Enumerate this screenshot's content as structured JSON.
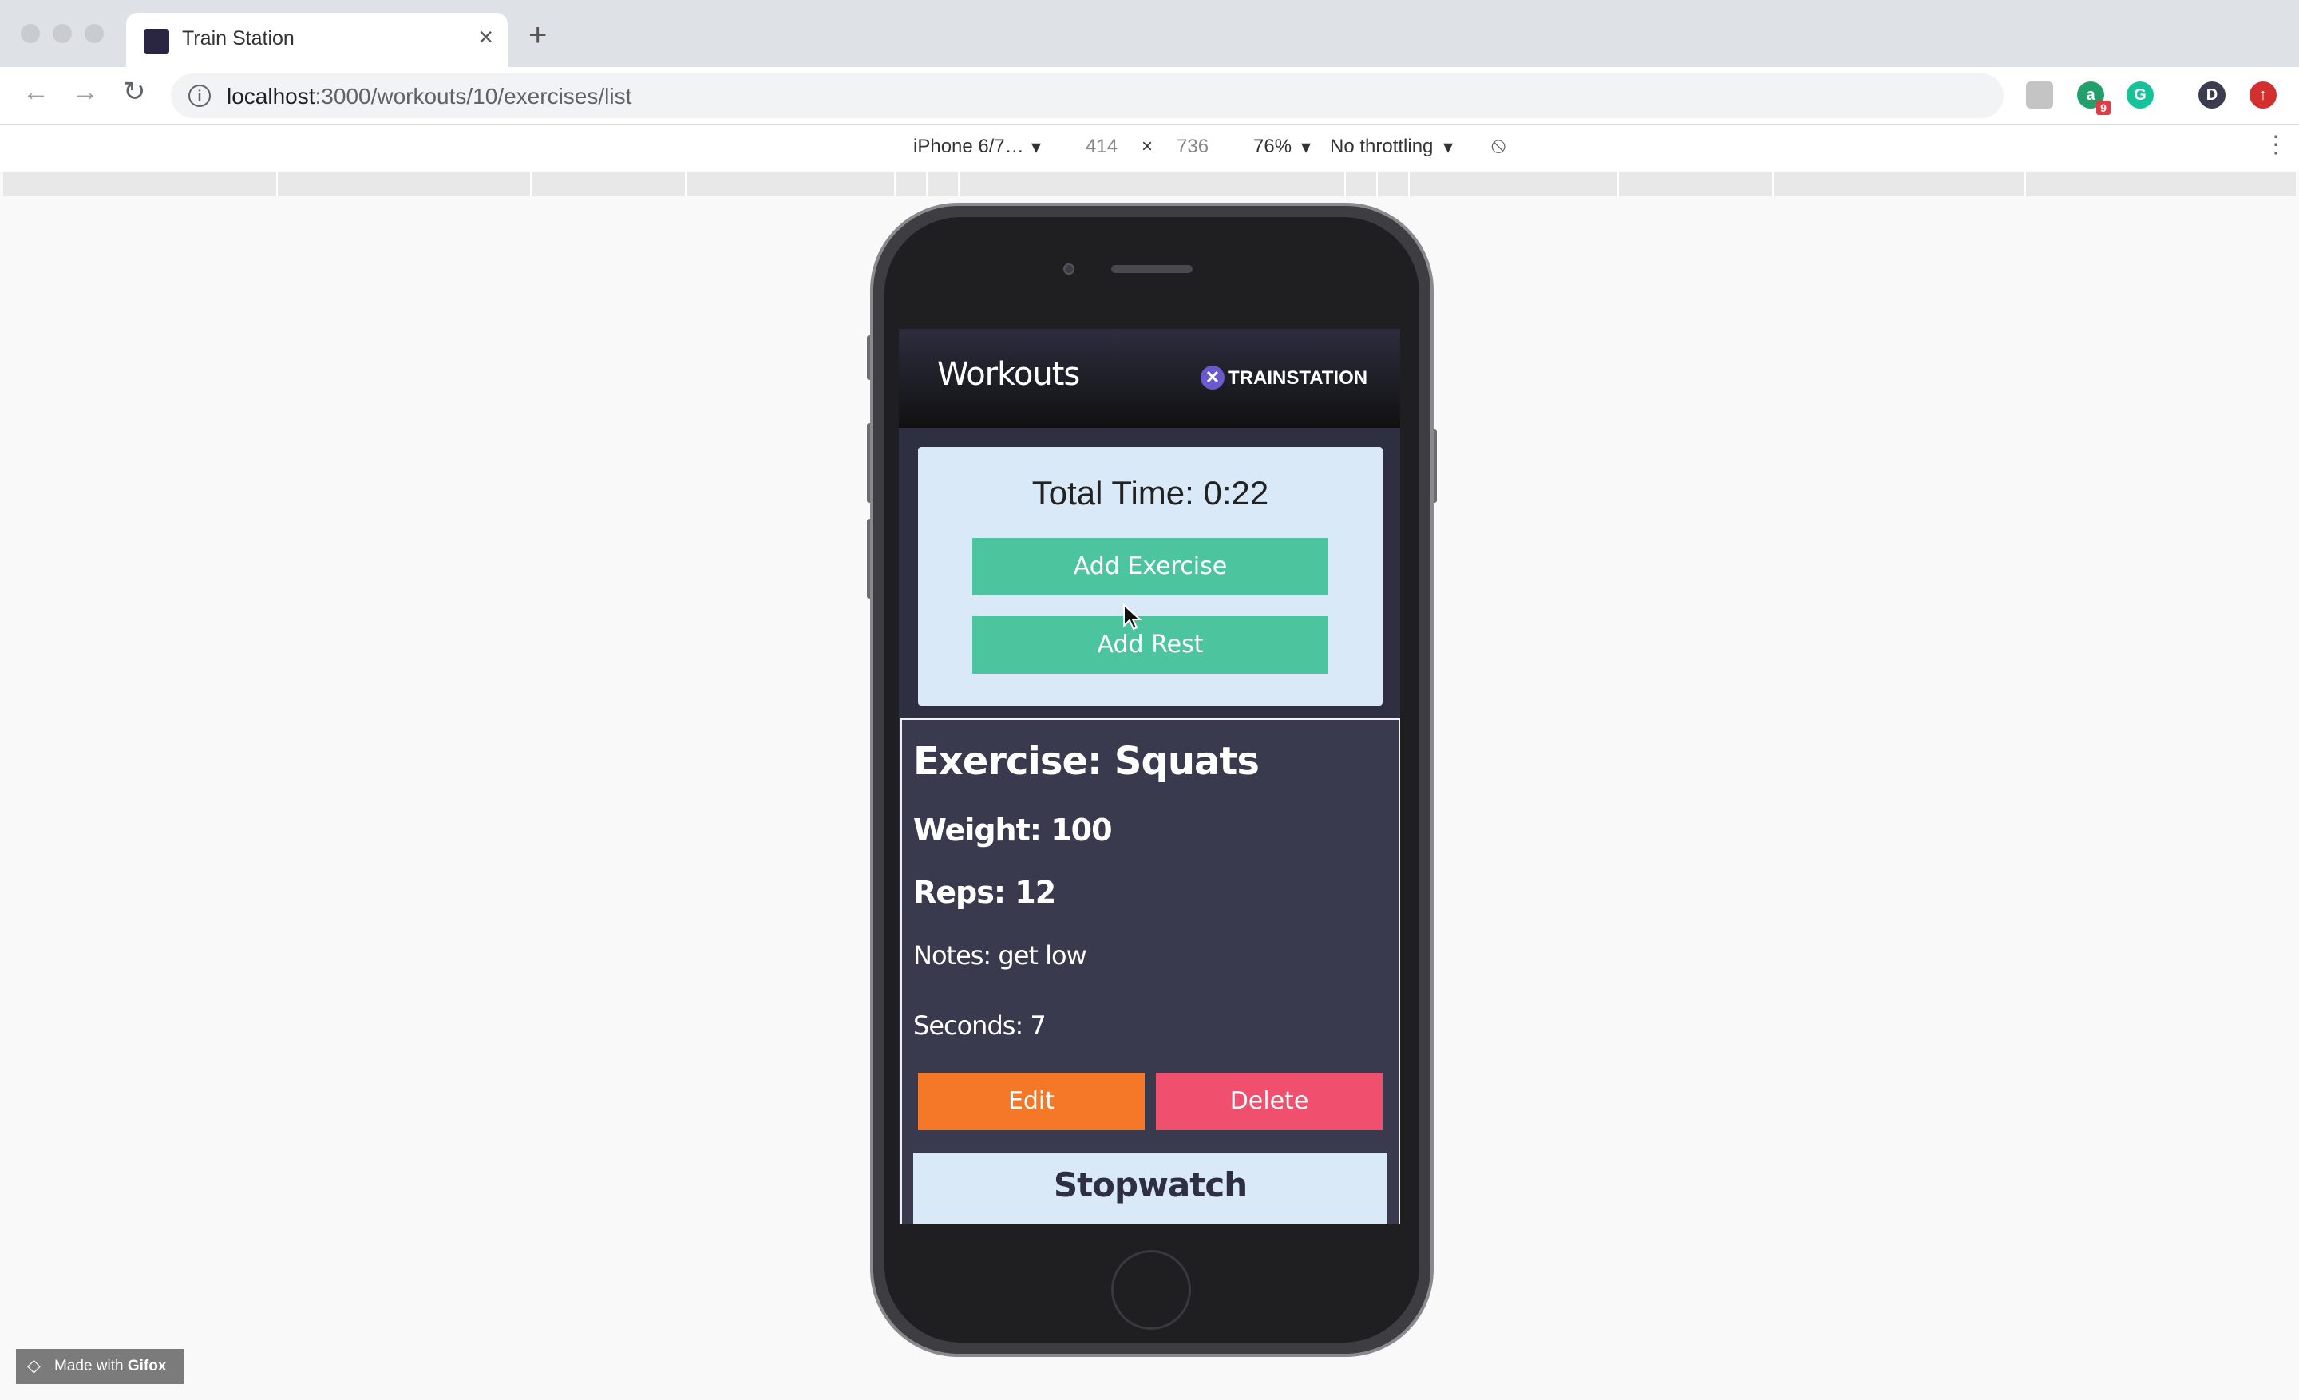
{
  "browser": {
    "tab_title": "Train Station",
    "url_host": "localhost",
    "url_path": ":3000/workouts/10/exercises/list",
    "profile_initial": "D",
    "ext_badge": "9"
  },
  "device_toolbar": {
    "device": "iPhone 6/7…",
    "width": "414",
    "times": "×",
    "height": "736",
    "zoom": "76%",
    "throttling": "No throttling"
  },
  "app": {
    "header_title": "Workouts",
    "logo_text": "TRAINSTATION",
    "total_time": "Total Time: 0:22",
    "add_exercise_label": "Add Exercise",
    "add_rest_label": "Add Rest",
    "exercise": {
      "name": "Exercise: Squats",
      "weight": "Weight: 100",
      "reps": "Reps: 12",
      "notes": "Notes: get low",
      "seconds": "Seconds: 7"
    },
    "edit_label": "Edit",
    "delete_label": "Delete",
    "stopwatch_title": "Stopwatch"
  },
  "watermark": {
    "prefix": "Made with ",
    "brand": "Gifox"
  },
  "colors": {
    "green": "#4cc59f",
    "edit": "#f47827",
    "delete": "#f0506e",
    "card_light": "#d9e9f7",
    "card_dark": "#3a3a4f"
  }
}
